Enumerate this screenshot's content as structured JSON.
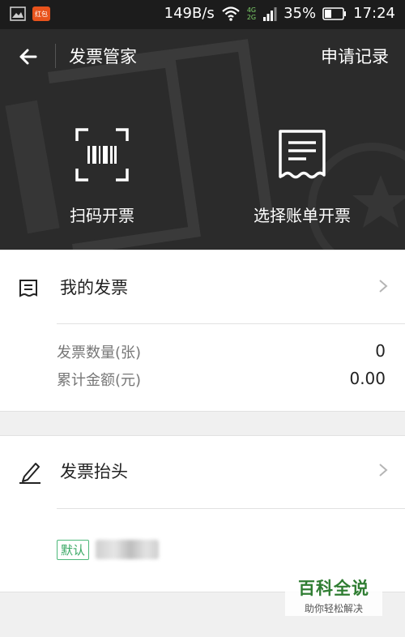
{
  "status_bar": {
    "speed": "149B/s",
    "network_top": "4G",
    "network_bottom": "2G",
    "battery": "35%",
    "time": "17:24",
    "app_badge": "红包"
  },
  "header": {
    "title": "发票管家",
    "record_link": "申请记录",
    "actions": [
      {
        "label": "扫码开票",
        "icon": "barcode-scan-icon"
      },
      {
        "label": "选择账单开票",
        "icon": "receipt-icon"
      }
    ]
  },
  "my_invoices": {
    "title": "我的发票",
    "icon": "invoice-list-icon",
    "count_label": "发票数量(张)",
    "count_value": "0",
    "amount_label": "累计金额(元)",
    "amount_value": "0.00"
  },
  "invoice_header": {
    "title": "发票抬头",
    "icon": "pencil-icon",
    "default_badge": "默认"
  },
  "watermark": {
    "title": "百科全说",
    "subtitle": "助你轻松解决"
  },
  "colors": {
    "header_bg": "#2b2b2b",
    "badge_green": "#3aa865",
    "watermark_green": "#2f7d32"
  }
}
